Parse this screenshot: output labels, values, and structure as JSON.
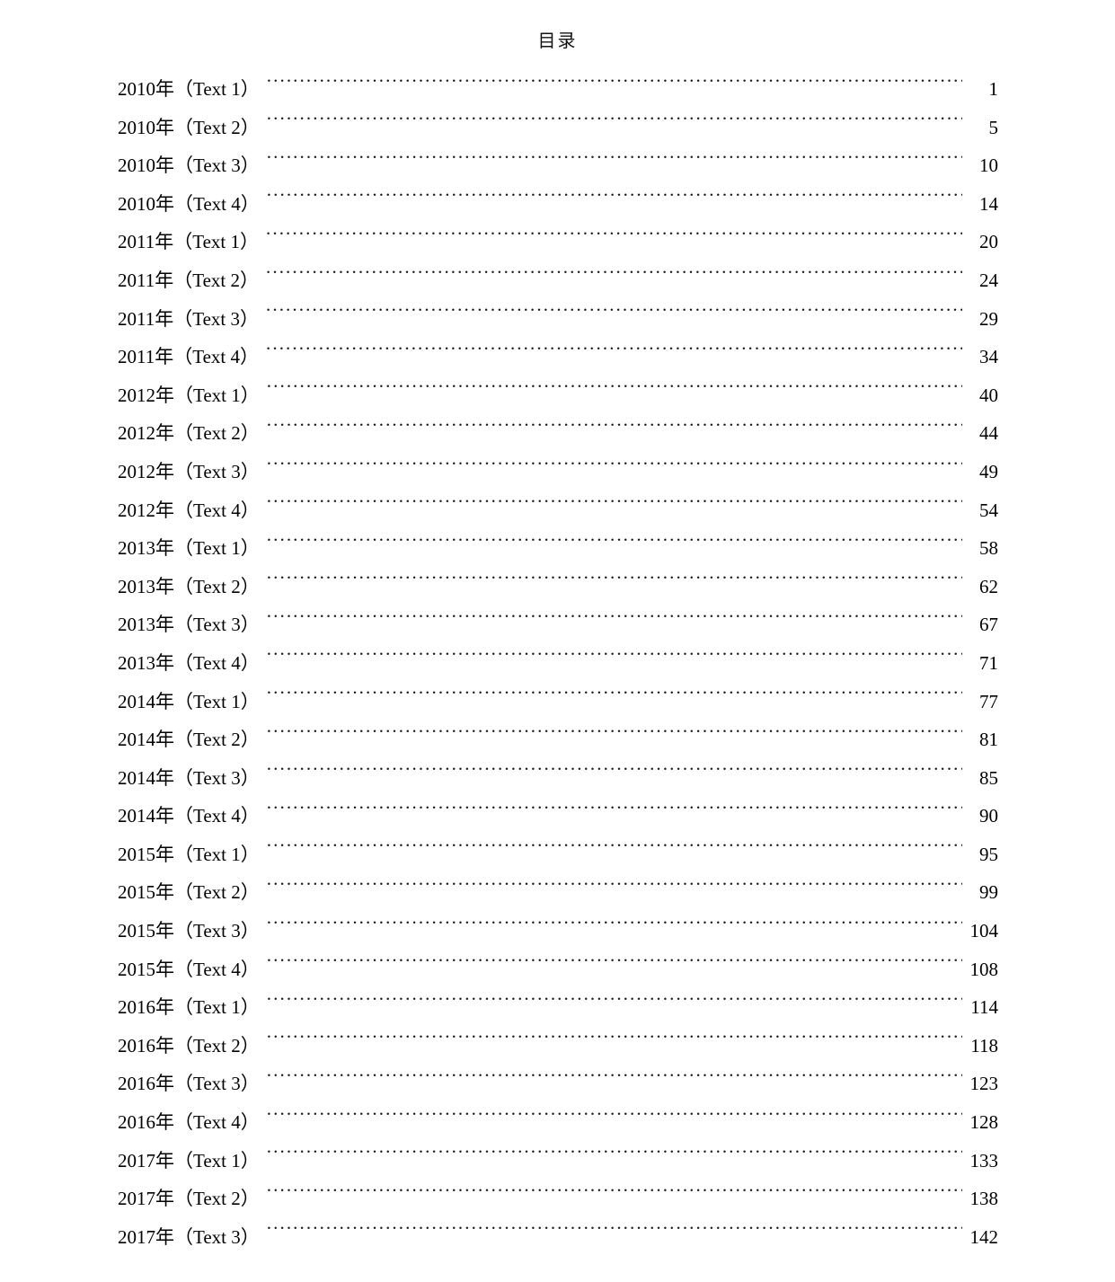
{
  "document": {
    "title": "目录"
  },
  "toc": {
    "entries": [
      {
        "label": "2010年（Text 1）",
        "page": "1"
      },
      {
        "label": "2010年（Text 2）",
        "page": "5"
      },
      {
        "label": "2010年（Text 3）",
        "page": "10"
      },
      {
        "label": "2010年（Text 4）",
        "page": "14"
      },
      {
        "label": "2011年（Text 1）",
        "page": "20"
      },
      {
        "label": "2011年（Text 2）",
        "page": "24"
      },
      {
        "label": "2011年（Text 3）",
        "page": "29"
      },
      {
        "label": "2011年（Text 4）",
        "page": "34"
      },
      {
        "label": "2012年（Text 1）",
        "page": "40"
      },
      {
        "label": "2012年（Text 2）",
        "page": "44"
      },
      {
        "label": "2012年（Text 3）",
        "page": "49"
      },
      {
        "label": "2012年（Text 4）",
        "page": "54"
      },
      {
        "label": "2013年（Text 1）",
        "page": "58"
      },
      {
        "label": "2013年（Text 2）",
        "page": "62"
      },
      {
        "label": "2013年（Text 3）",
        "page": "67"
      },
      {
        "label": "2013年（Text 4）",
        "page": "71"
      },
      {
        "label": "2014年（Text 1）",
        "page": "77"
      },
      {
        "label": "2014年（Text 2）",
        "page": "81"
      },
      {
        "label": "2014年（Text 3）",
        "page": "85"
      },
      {
        "label": "2014年（Text 4）",
        "page": "90"
      },
      {
        "label": "2015年（Text 1）",
        "page": "95"
      },
      {
        "label": "2015年（Text 2）",
        "page": "99"
      },
      {
        "label": "2015年（Text 3）",
        "page": "104"
      },
      {
        "label": "2015年（Text 4）",
        "page": "108"
      },
      {
        "label": "2016年（Text 1）",
        "page": "114"
      },
      {
        "label": "2016年（Text 2）",
        "page": "118"
      },
      {
        "label": "2016年（Text 3）",
        "page": "123"
      },
      {
        "label": "2016年（Text 4）",
        "page": "128"
      },
      {
        "label": "2017年（Text 1）",
        "page": "133"
      },
      {
        "label": "2017年（Text 2）",
        "page": "138"
      },
      {
        "label": "2017年（Text 3）",
        "page": "142"
      }
    ]
  }
}
